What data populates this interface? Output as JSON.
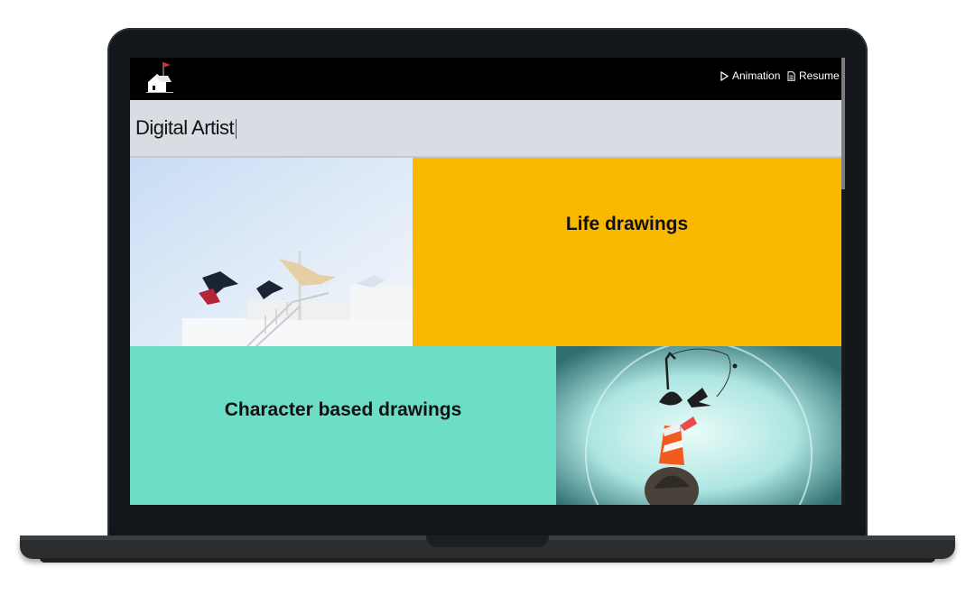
{
  "nav": {
    "logo": "house-with-flag-logo",
    "links": [
      {
        "label": "Animation",
        "icon": "play-icon"
      },
      {
        "label": "Resume",
        "icon": "document-icon"
      }
    ]
  },
  "header": {
    "title": "Digital Artist"
  },
  "gallery": {
    "tiles": [
      {
        "kind": "image",
        "subject": "laundry-on-rooftop-photo"
      },
      {
        "kind": "label",
        "label": "Life drawings",
        "color": "#fbb800"
      },
      {
        "kind": "label",
        "label": "Character based drawings",
        "color": "#6cdec5"
      },
      {
        "kind": "image",
        "subject": "character-illustration"
      }
    ]
  },
  "colors": {
    "navbar": "#000000",
    "header_band": "#d8dde3",
    "life_tile": "#fbb800",
    "character_tile": "#6cdec5"
  }
}
